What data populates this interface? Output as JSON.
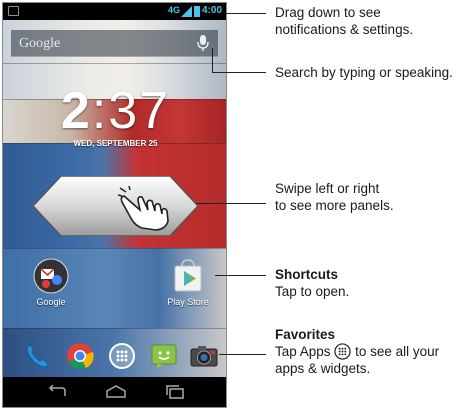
{
  "status_bar": {
    "network_type": "4G",
    "time": "4:00",
    "accent_color": "#4cc3ea"
  },
  "search_bar": {
    "logo_text": "Google",
    "mic_icon": "microphone-icon"
  },
  "lock_clock": {
    "hour": "2",
    "minutes": ":37",
    "date": "WED, SEPTEMBER 25"
  },
  "shortcuts": [
    {
      "label": "Google",
      "icon": "gmail-folder-icon"
    },
    {
      "label": "Play Store",
      "icon": "play-store-icon"
    }
  ],
  "dock": [
    {
      "icon": "phone-icon"
    },
    {
      "icon": "chrome-icon"
    },
    {
      "icon": "apps-icon"
    },
    {
      "icon": "messaging-icon"
    },
    {
      "icon": "camera-icon"
    }
  ],
  "nav_bar": {
    "buttons": [
      "back-icon",
      "home-icon",
      "recent-apps-icon"
    ]
  },
  "callouts": {
    "notifications": {
      "line1": "Drag down to see",
      "line2": "notifications & settings."
    },
    "search": {
      "line1": "Search by typing or speaking."
    },
    "swipe": {
      "line1": "Swipe left or right",
      "line2": "to see more panels."
    },
    "shortcuts": {
      "title": "Shortcuts",
      "line1": "Tap to open."
    },
    "favorites": {
      "title": "Favorites",
      "line1_before": "Tap Apps",
      "line1_after": "to see all your",
      "line2": "apps & widgets."
    }
  }
}
